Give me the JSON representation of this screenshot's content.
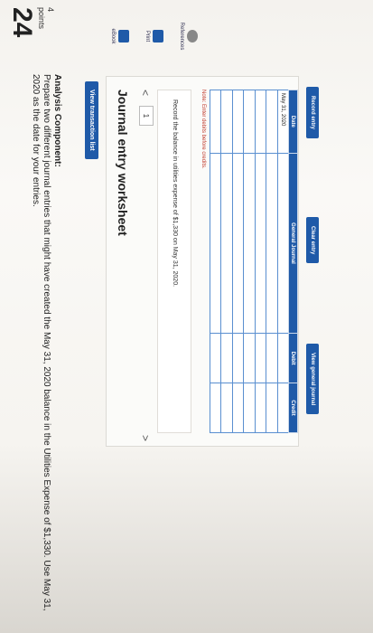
{
  "question": {
    "number": "24",
    "points_value": "4",
    "points_label": "points"
  },
  "rail": {
    "ebook": "eBook",
    "print": "Print",
    "references": "References"
  },
  "header": {
    "title": "Analysis Component:",
    "line1": "Prepare two different journal entries that might have created the May 31, 2020 balance in the Utilities Expense of $1,330. Use May 31,",
    "line2": "2020 as the date for your entries."
  },
  "buttons": {
    "view_transaction_list": "View transaction list",
    "record_entry": "Record entry",
    "clear_entry": "Clear entry",
    "view_general_journal": "View general journal"
  },
  "worksheet": {
    "title": "Journal entry worksheet",
    "nav_prev": "<",
    "nav_current": "1",
    "nav_next": ">",
    "instruction": "Record the balance in utilities expense of $1,330 on May 31, 2020.",
    "note": "Note: Enter debits before credits."
  },
  "table": {
    "headers": [
      "Date",
      "General Journal",
      "Debit",
      "Credit"
    ],
    "rows": [
      [
        "May 31, 2020",
        "",
        "",
        ""
      ],
      [
        "",
        "",
        "",
        ""
      ],
      [
        "",
        "",
        "",
        ""
      ],
      [
        "",
        "",
        "",
        ""
      ],
      [
        "",
        "",
        "",
        ""
      ],
      [
        "",
        "",
        "",
        ""
      ],
      [
        "",
        "",
        "",
        ""
      ]
    ]
  },
  "colors": {
    "accent": "#1f5aa8",
    "note_red": "#c0392b"
  }
}
